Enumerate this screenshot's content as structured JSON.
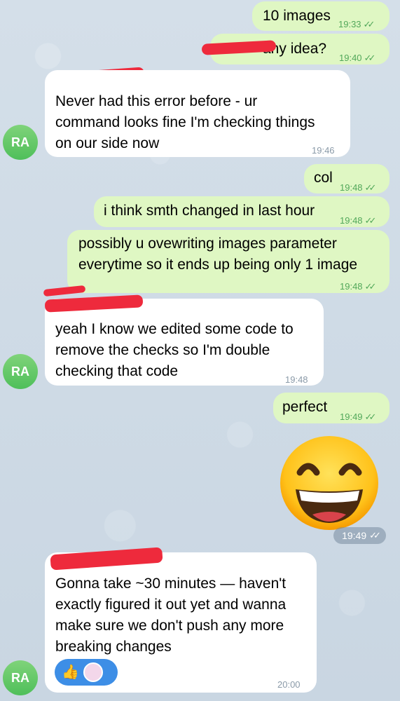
{
  "avatar_initials": "RA",
  "messages": [
    {
      "text": "10 images",
      "time": "19:33"
    },
    {
      "text": "any idea?",
      "time": "19:40"
    },
    {
      "lines": [
        "Never had this error before - ur",
        "command looks fine I'm checking things",
        "on our side now"
      ],
      "time": "19:46"
    },
    {
      "text": "col",
      "time": "19:48"
    },
    {
      "text": "i think smth changed in last hour",
      "time": "19:48"
    },
    {
      "lines": [
        "possibly u ovewriting images parameter",
        "everytime so it ends up being only 1 image"
      ],
      "time": "19:48"
    },
    {
      "lines": [
        "yeah I know we edited some code to",
        "remove the checks so I'm double",
        "checking that code"
      ],
      "time": "19:48"
    },
    {
      "text": "perfect",
      "time": "19:49"
    },
    {
      "time": "19:49"
    },
    {
      "lines": [
        "Gonna take ~30 minutes — haven't",
        "exactly figured it out yet and wanna",
        "make sure we don't push any more",
        "breaking changes"
      ],
      "time": "20:00"
    }
  ],
  "icons": {
    "read_receipt": "double-check-icon",
    "sticker": "grinning-face-icon",
    "reaction_1": "thumbs-up-icon",
    "reaction_2": "axolotl-avatar-icon"
  },
  "colors": {
    "outgoing_bubble": "#dff7c3",
    "incoming_bubble": "#ffffff",
    "avatar": "#4fbf5a",
    "redaction": "#ee2a3c",
    "reaction_pill": "#3d8ee6"
  }
}
